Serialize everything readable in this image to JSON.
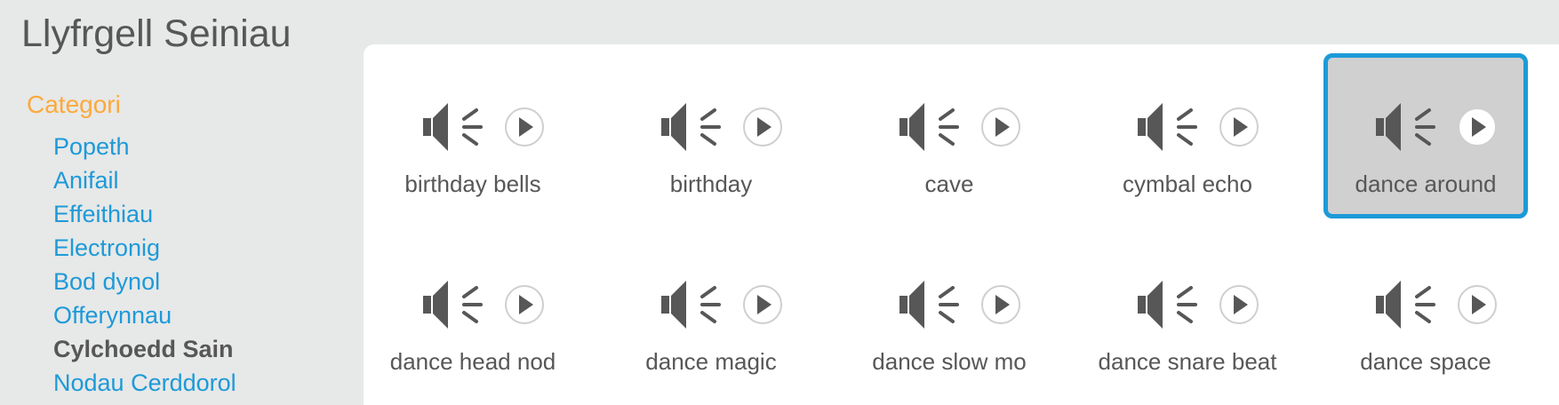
{
  "title": "Llyfrgell Seiniau",
  "sidebar": {
    "heading": "Categori",
    "items": [
      {
        "label": "Popeth"
      },
      {
        "label": "Anifail"
      },
      {
        "label": "Effeithiau"
      },
      {
        "label": "Electronig"
      },
      {
        "label": "Bod dynol"
      },
      {
        "label": "Offerynnau"
      },
      {
        "label": "Cylchoedd Sain"
      },
      {
        "label": "Nodau Cerddorol"
      }
    ],
    "selected_index": 6
  },
  "sounds": [
    {
      "label": "birthday bells"
    },
    {
      "label": "birthday"
    },
    {
      "label": "cave"
    },
    {
      "label": "cymbal echo"
    },
    {
      "label": "dance around"
    },
    {
      "label": "dance head nod"
    },
    {
      "label": "dance magic"
    },
    {
      "label": "dance slow mo"
    },
    {
      "label": "dance snare beat"
    },
    {
      "label": "dance space"
    }
  ],
  "selected_sound_index": 4,
  "icons": {
    "speaker": "speaker-icon",
    "play": "play-icon"
  },
  "colors": {
    "category_heading": "#fbaa3c",
    "link": "#1d9ad8",
    "selected_border": "#1d9ad8",
    "selected_background": "#d0d0d0",
    "text": "#575757",
    "icon": "#575757"
  }
}
